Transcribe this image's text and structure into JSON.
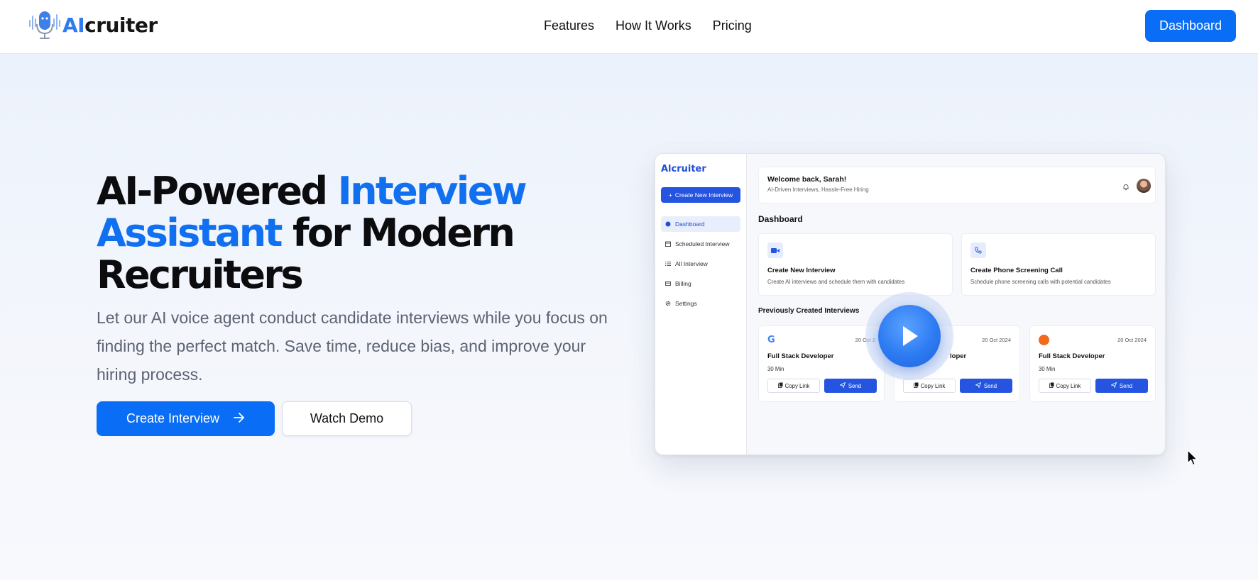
{
  "brand": {
    "ai": "AI",
    "rest": "cruiter"
  },
  "nav": {
    "links": [
      "Features",
      "How It Works",
      "Pricing"
    ],
    "dashboard_label": "Dashboard"
  },
  "hero": {
    "title_part1": "AI-Powered ",
    "title_accent": "Interview Assistant",
    "title_part2": " for Modern Recruiters",
    "subtitle": "Let our AI voice agent conduct candidate interviews while you focus on finding the perfect match. Save time, reduce bias, and improve your hiring process.",
    "create_label": "Create Interview",
    "demo_label": "Watch Demo"
  },
  "preview": {
    "brand": "Alcruiter",
    "new_interview_label": "Create New Interview",
    "nav": [
      {
        "label": "Dashboard",
        "icon": "dashboard-icon",
        "active": true
      },
      {
        "label": "Scheduled Interview",
        "icon": "calendar-icon",
        "active": false
      },
      {
        "label": "All Interview",
        "icon": "list-icon",
        "active": false
      },
      {
        "label": "Billing",
        "icon": "card-icon",
        "active": false
      },
      {
        "label": "Settings",
        "icon": "gear-icon",
        "active": false
      }
    ],
    "welcome_title": "Welcome back, Sarah!",
    "welcome_sub": "AI-Driven Interviews, Hassle-Free Hiring",
    "dashboard_title": "Dashboard",
    "cards": [
      {
        "title": "Create New Interview",
        "sub": "Create AI interviews and schedule them with candidates"
      },
      {
        "title": "Create Phone Screening Call",
        "sub": "Schedule phone screening calls with potential candidates"
      }
    ],
    "previous_title": "Previously Created Interviews",
    "interviews": [
      {
        "date": "20 Oct 2",
        "title": "Full Stack Developer",
        "duration": "30 Min",
        "copy": "Copy Link",
        "send": "Send"
      },
      {
        "date": "20 Oct 2024",
        "title": "loper",
        "duration": "",
        "copy": "Copy Link",
        "send": "Send"
      },
      {
        "date": "20 Oct 2024",
        "title": "Full Stack Developer",
        "duration": "30 Min",
        "copy": "Copy Link",
        "send": "Send"
      }
    ]
  },
  "colors": {
    "accent": "#0a6df5",
    "preview_accent": "#2454e0",
    "brand_ai": "#2f7bef"
  }
}
